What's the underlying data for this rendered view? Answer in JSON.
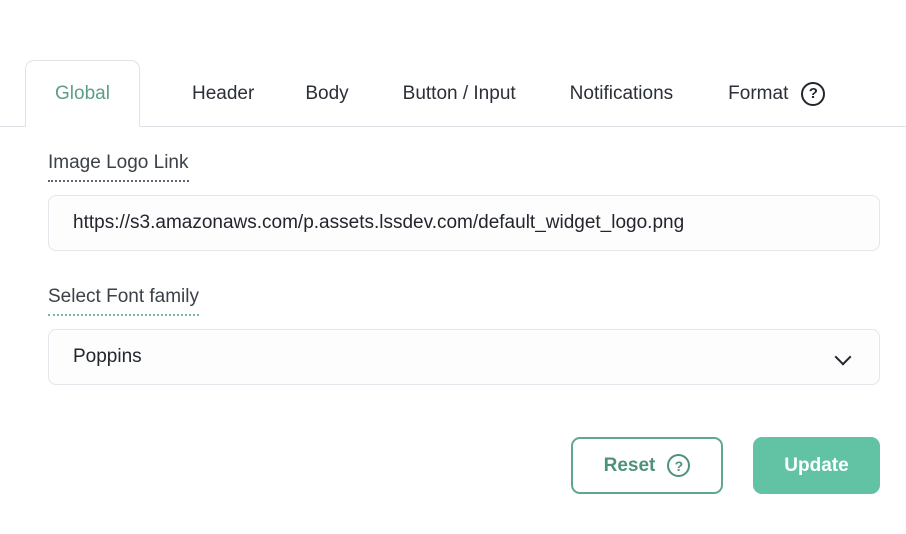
{
  "tabs": [
    {
      "id": "global",
      "label": "Global",
      "active": true
    },
    {
      "id": "header",
      "label": "Header",
      "active": false
    },
    {
      "id": "body",
      "label": "Body",
      "active": false
    },
    {
      "id": "button-input",
      "label": "Button / Input",
      "active": false
    },
    {
      "id": "notifications",
      "label": "Notifications",
      "active": false
    },
    {
      "id": "format",
      "label": "Format",
      "active": false
    }
  ],
  "tab_help_icon": "question-mark-circle-icon",
  "form": {
    "image_logo_link": {
      "label": "Image Logo Link",
      "value": "https://s3.amazonaws.com/p.assets.lssdev.com/default_widget_logo.png",
      "placeholder": "https://s3.amazonaws.com/p.assets.lssdev.com/default_widget_logo.png"
    },
    "font_family": {
      "label": "Select Font family",
      "value": "Poppins",
      "dropdown_icon": "chevron-down-icon"
    }
  },
  "actions": {
    "reset_label": "Reset",
    "reset_help_icon": "question-mark-circle-icon",
    "update_label": "Update"
  },
  "colors": {
    "accent_green": "#62c3a4",
    "active_tab_text": "#5d9f84",
    "reset_border": "#5ea98c",
    "label_text": "#3b4149",
    "border_gray": "#e3e6ea"
  }
}
